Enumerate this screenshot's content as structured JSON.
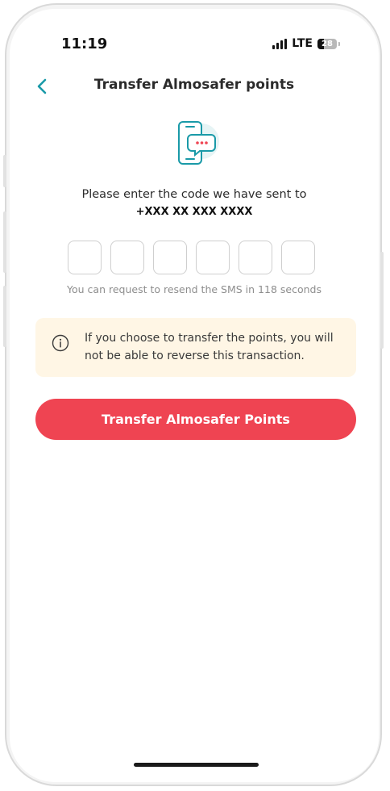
{
  "status_bar": {
    "time": "11:19",
    "network": "LTE",
    "battery": "28"
  },
  "header": {
    "title": "Transfer Almosafer points",
    "back_icon": "chevron-left-icon"
  },
  "hero": {
    "icon": "phone-chat-icon"
  },
  "verification": {
    "prompt": "Please enter the code we have sent to",
    "phone_number": "+XXX XX XXX XXXX",
    "digit_count": 6,
    "resend_text": "You can request to resend the SMS in 118 seconds"
  },
  "warning": {
    "icon": "info-icon",
    "message": "If you choose to transfer the points, you will not be able to reverse this transaction."
  },
  "actions": {
    "submit_label": "Transfer Almosafer Points"
  },
  "colors": {
    "accent": "#ef4452",
    "teal": "#1a9aa8",
    "warning_bg": "#fff6e5"
  }
}
